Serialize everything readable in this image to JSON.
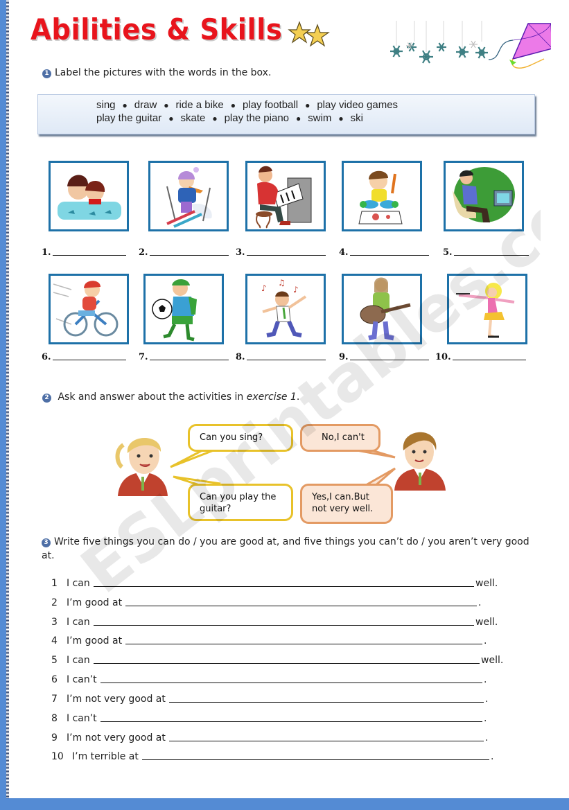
{
  "title": "Abilities & Skills",
  "exercise1": {
    "number": "1",
    "instruction": "Label the pictures with the words in the box.",
    "word_box": {
      "line1": [
        "sing",
        "draw",
        "ride a bike",
        "play football",
        "play video games"
      ],
      "line2": [
        "play the guitar",
        "skate",
        "play the piano",
        "swim",
        "ski"
      ],
      "bullet": "●"
    },
    "pictures": [
      {
        "label": "1.",
        "depicts": "swim"
      },
      {
        "label": "2.",
        "depicts": "ski"
      },
      {
        "label": "3.",
        "depicts": "play the piano"
      },
      {
        "label": "4.",
        "depicts": "draw"
      },
      {
        "label": "5.",
        "depicts": "play video games"
      },
      {
        "label": "6.",
        "depicts": "ride a bike"
      },
      {
        "label": "7.",
        "depicts": "play football"
      },
      {
        "label": "8.",
        "depicts": "sing"
      },
      {
        "label": "9.",
        "depicts": "play the guitar"
      },
      {
        "label": "10.",
        "depicts": "skate"
      }
    ]
  },
  "exercise2": {
    "number": "2",
    "instruction_prefix": "Ask and answer about the activities in ",
    "instruction_ref": "exercise 1",
    "instruction_suffix": ".",
    "bubbles": {
      "q1": "Can you sing?",
      "a1": "No,I can't",
      "q2": "Can you play the guitar?",
      "a2": "Yes,I can.But not very well."
    }
  },
  "exercise3": {
    "number": "3",
    "instruction": "Write five things you can do / you are good at, and five things you can’t do / you aren’t very good at.",
    "lines": [
      {
        "num": "1",
        "prefix": "I can",
        "suffix": "well."
      },
      {
        "num": "2",
        "prefix": "I’m good at",
        "suffix": "."
      },
      {
        "num": "3",
        "prefix": "I can",
        "suffix": "well."
      },
      {
        "num": "4",
        "prefix": "I’m good at",
        "suffix": "."
      },
      {
        "num": "5",
        "prefix": "I can",
        "suffix": "well."
      },
      {
        "num": "6",
        "prefix": "I can’t",
        "suffix": "."
      },
      {
        "num": "7",
        "prefix": "I’m not very good at",
        "suffix": "."
      },
      {
        "num": "8",
        "prefix": "I can’t",
        "suffix": "."
      },
      {
        "num": "9",
        "prefix": "I’m not very good at",
        "suffix": "."
      },
      {
        "num": "10",
        "prefix": "I’m terrible at",
        "suffix": "."
      }
    ]
  },
  "watermark": "ESLprintables.com",
  "colors": {
    "title": "#e8141c",
    "frame": "#1d71a8",
    "page_border": "#548bd4",
    "bubble_yellow": "#e8c22a",
    "bubble_orange": "#e39a63"
  }
}
